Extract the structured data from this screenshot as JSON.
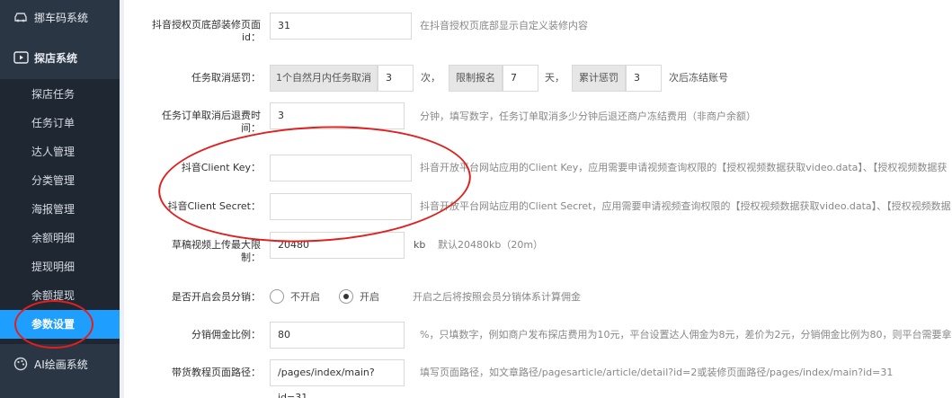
{
  "sidebar": {
    "groups": [
      {
        "label": "挪车码系统",
        "icon": "car-icon"
      },
      {
        "label": "探店系统",
        "icon": "video-icon"
      },
      {
        "label": "AI绘画系统",
        "icon": "palette-icon"
      }
    ],
    "items": [
      {
        "label": "探店任务"
      },
      {
        "label": "任务订单"
      },
      {
        "label": "达人管理"
      },
      {
        "label": "分类管理"
      },
      {
        "label": "海报管理"
      },
      {
        "label": "余额明细"
      },
      {
        "label": "提现明细"
      },
      {
        "label": "余额提现"
      },
      {
        "label": "参数设置"
      }
    ],
    "active_item": "参数设置"
  },
  "form": {
    "footer_decor": {
      "label": "抖音授权页底部装修页面id：",
      "value": "31",
      "hint": "在抖音授权页底部显示自定义装修内容"
    },
    "task_cancel": {
      "label": "任务取消惩罚：",
      "addon1": "1个自然月内任务取消",
      "value1": "3",
      "unit1": "次，",
      "addon2": "限制报名",
      "value2": "7",
      "unit2": "天，",
      "addon3": "累计惩罚",
      "value3": "3",
      "unit3": "次后冻结账号"
    },
    "refund_time": {
      "label": "任务订单取消后退费时间：",
      "value": "3",
      "hint": "分钟，填写数字，任务订单取消多少分钟后退还商户冻结费用（非商户余额）"
    },
    "client_key": {
      "label": "抖音Client Key：",
      "value": "",
      "hint": "抖音开放平台网站应用的Client Key，应用需要申请视频查询权限的【授权视频数据获取video.data】、【授权视频数据获"
    },
    "client_secret": {
      "label": "抖音Client Secret：",
      "value": "",
      "hint": "抖音开放平台网站应用的Client Secret，应用需要申请视频查询权限的【授权视频数据获取video.data】、【授权视频数据"
    },
    "video_limit": {
      "label": "草稿视频上传最大限制：",
      "value": "20480",
      "unit": "kb",
      "hint": "默认20480kb（20m）"
    },
    "member_distribution": {
      "label": "是否开启会员分销：",
      "option_off": "不开启",
      "option_on": "开启",
      "selected": "开启",
      "hint": "开启之后将按照会员分销体系计算佣金"
    },
    "commission_ratio": {
      "label": "分销佣金比例：",
      "value": "80",
      "hint": "%，只填数字，例如商户发布探店费用为10元，平台设置达人佣金为8元，差价为2元，分销佣金比例为80，则平台需要拿"
    },
    "tutorial_path": {
      "label": "带货教程页面路径：",
      "value": "/pages/index/main?id=31",
      "hint": "填写页面路径，如文章路径/pagesarticle/article/detail?id=2或装修页面路径/pages/index/main?id=31"
    }
  },
  "colors": {
    "sidebar_bg": "#2b3644",
    "submenu_bg": "#1f2733",
    "active_bg": "#1e9fff",
    "annotation": "#e0201e"
  }
}
